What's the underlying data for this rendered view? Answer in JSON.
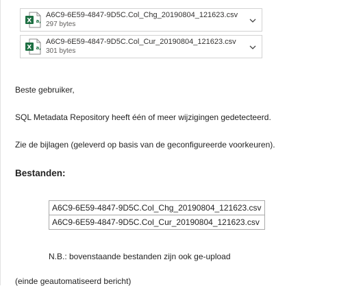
{
  "attachments": [
    {
      "filename": "A6C9-6E59-4847-9D5C.Col_Chg_20190804_121623.csv",
      "size": "297 bytes",
      "icon": "excel-csv-icon"
    },
    {
      "filename": "A6C9-6E59-4847-9D5C.Col_Cur_20190804_121623.csv",
      "size": "301 bytes",
      "icon": "excel-csv-icon"
    }
  ],
  "message": {
    "greeting": "Beste gebruiker,",
    "line1": "SQL Metadata Repository heeft één of meer wijzigingen gedetecteerd.",
    "line2": "Zie de bijlagen (geleverd op basis van de geconfigureerde voorkeuren).",
    "files_heading": "Bestanden:",
    "files": [
      "A6C9-6E59-4847-9D5C.Col_Chg_20190804_121623.csv",
      "A6C9-6E59-4847-9D5C.Col_Cur_20190804_121623.csv"
    ],
    "note": "N.B.: bovenstaande bestanden zijn ook ge-upload",
    "closing": "(einde geautomatiseerd bericht)"
  },
  "colors": {
    "excel_green": "#1d6f42",
    "border": "#d2d2d2"
  }
}
